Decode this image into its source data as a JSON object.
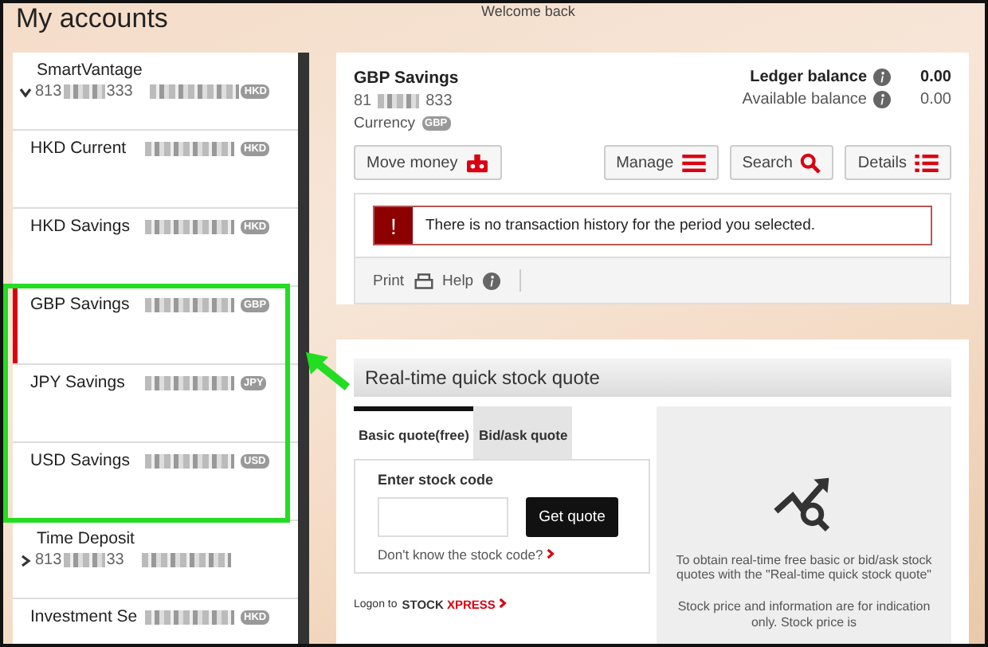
{
  "header": {
    "title": "My accounts",
    "greeting": "Welcome back"
  },
  "accounts": [
    {
      "kind": "group",
      "name": "SmartVantage",
      "number_prefix": "813",
      "number_suffix": "333",
      "currency": "HKD",
      "selected": false,
      "expanded": true
    },
    {
      "kind": "account",
      "name": "HKD Current",
      "currency": "HKD",
      "selected": false
    },
    {
      "kind": "account",
      "name": "HKD Savings",
      "currency": "HKD",
      "selected": false
    },
    {
      "kind": "account",
      "name": "GBP Savings",
      "currency": "GBP",
      "selected": true
    },
    {
      "kind": "account",
      "name": "JPY Savings",
      "currency": "JPY",
      "selected": false
    },
    {
      "kind": "account",
      "name": "USD Savings",
      "currency": "USD",
      "selected": false
    },
    {
      "kind": "group",
      "name": "Time Deposit",
      "number_prefix": "813",
      "number_suffix": "33",
      "selected": false,
      "expanded": false
    },
    {
      "kind": "account",
      "name": "Investment Se",
      "currency": "HKD",
      "selected": false
    }
  ],
  "detail": {
    "name": "GBP Savings",
    "number_prefix": "81",
    "number_suffix": "833",
    "currency_label": "Currency",
    "currency": "GBP",
    "balances": [
      {
        "label": "Ledger balance",
        "value": "0.00",
        "primary": true
      },
      {
        "label": "Available balance",
        "value": "0.00",
        "primary": false
      }
    ],
    "buttons": [
      {
        "label": "Move money",
        "kind": "move"
      },
      {
        "label": "Manage",
        "kind": "manage"
      },
      {
        "label": "Search",
        "kind": "search"
      },
      {
        "label": "Details",
        "kind": "details"
      }
    ],
    "alert": {
      "icon": "!",
      "message": "There is no transaction history for the period you selected."
    },
    "footer": {
      "print": "Print",
      "help": "Help"
    }
  },
  "stock_quote": {
    "title": "Real-time quick stock quote",
    "tabs": [
      {
        "label": "Basic quote(free)",
        "selected": true
      },
      {
        "label": "Bid/ask quote",
        "selected": false
      }
    ],
    "field_label": "Enter stock code",
    "button": "Get quote",
    "help_link": "Don't know the stock code?",
    "logon_prefix": "Logon to",
    "logon_brand_1": "STOCK",
    "logon_brand_2": "XPRESS",
    "info": "To obtain real-time free basic or bid/ask stock quotes with the \"Real-time quick stock quote\"",
    "note": "Stock price and information are for indication only. Stock price is"
  }
}
